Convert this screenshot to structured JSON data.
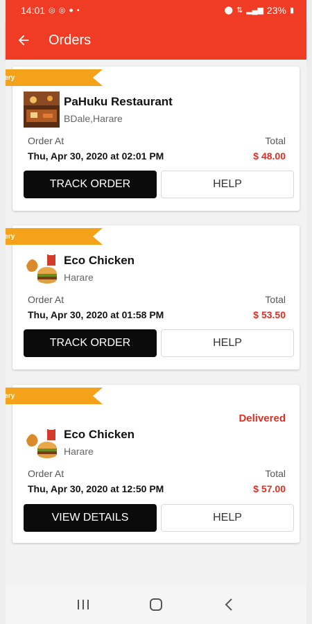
{
  "status_bar": {
    "time": "14:01",
    "battery": "23%"
  },
  "app_bar": {
    "title": "Orders"
  },
  "colors": {
    "primary": "#f03c24",
    "ribbon": "#f5a21b",
    "price": "#e62b1f",
    "button_dark": "#0b0b0b"
  },
  "orders": [
    {
      "ribbon": "ivery",
      "restaurant": "PaHuku Restaurant",
      "location": "BDale,Harare",
      "order_at_label": "Order At",
      "date": "Thu, Apr 30, 2020 at 02:01 PM",
      "total_label": "Total",
      "total": "$ 48.00",
      "primary_action": "TRACK ORDER",
      "secondary_action": "HELP",
      "status": "",
      "thumb_icon": "restaurant-photo"
    },
    {
      "ribbon": "ivery",
      "restaurant": "Eco Chicken",
      "location": "Harare",
      "order_at_label": "Order At",
      "date": "Thu, Apr 30, 2020 at 01:58 PM",
      "total_label": "Total",
      "total": "$ 53.50",
      "primary_action": "TRACK ORDER",
      "secondary_action": "HELP",
      "status": "",
      "thumb_icon": "fast-food-icon"
    },
    {
      "ribbon": "ivery",
      "restaurant": "Eco Chicken",
      "location": "Harare",
      "order_at_label": "Order At",
      "date": "Thu, Apr 30, 2020 at 12:50 PM",
      "total_label": "Total",
      "total": "$ 57.00",
      "primary_action": "VIEW DETAILS",
      "secondary_action": "HELP",
      "status": "Delivered",
      "thumb_icon": "fast-food-icon"
    }
  ]
}
